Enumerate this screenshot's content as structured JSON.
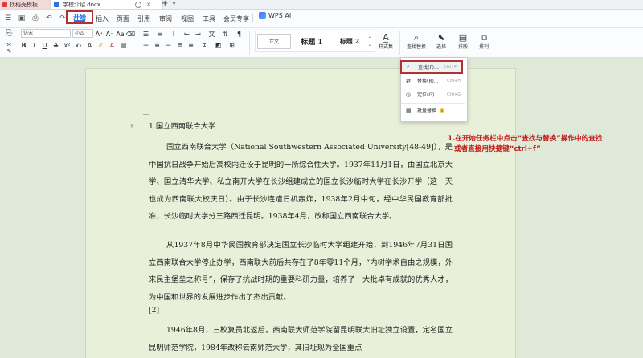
{
  "tabs": {
    "first_label": "找稻壳模板",
    "doc_label": "学校介绍.docx",
    "add": "+",
    "dropdown": "∨"
  },
  "menus": {
    "start": "开始",
    "insert": "插入",
    "page": "页面",
    "reference": "引用",
    "review": "审阅",
    "view": "视图",
    "tools": "工具",
    "member": "会员专享",
    "wps_ai": "WPS AI"
  },
  "ribbon": {
    "font_name": "仿宋",
    "font_size": "小四",
    "styles": [
      "正文",
      "标题 1",
      "标题 2"
    ],
    "style_set": "样式集",
    "find_replace": "查找替换",
    "select": "选择",
    "layout": "排版",
    "arrange": "排列"
  },
  "find_menu": {
    "find": {
      "label": "查找(F)...",
      "shortcut": "Ctrl+F"
    },
    "replace": {
      "label": "替换(R)...",
      "shortcut": "Ctrl+H"
    },
    "goto": {
      "label": "定位(G)...",
      "shortcut": "Ctrl+G"
    },
    "batch": {
      "label": "批量替换"
    }
  },
  "document": {
    "heading": "1.国立西南联合大学",
    "p1": "国立西南联合大学（National Southwestern Associated University[48-49]），是中国抗日战争开始后高校内迁设于昆明的一所综合性大学。1937年11月1日，由国立北京大学、国立清华大学、私立南开大学在长沙组建成立的国立长沙临时大学在长沙开学（这一天也成为西南联大校庆日）。由于长沙连遭日机轰炸，1938年2月中旬，经中华民国教育部批准，长沙临时大学分三路西迁昆明。1938年4月，改称国立西南联合大学。",
    "p2": "从1937年8月中华民国教育部决定国立长沙临时大学组建开始，到1946年7月31日国立西南联合大学停止办学，西南联大前后共存在了8年零11个月，“内树学术自由之规模，外来民主堡垒之称号”，保存了抗战时期的重要科研力量，培养了一大批卓有成就的优秀人才，为中国和世界的发展进步作出了杰出贡献。",
    "p3": "[2]",
    "p4": "1946年8月，三校复员北返后，西南联大师范学院留昆明联大旧址独立设置，定名国立昆明师范学院，1984年改称云南师范大学，其旧址现为全国重点"
  },
  "annotation": {
    "line1": "1.在开始任务栏中点击“查找与替换”操作中的查找",
    "line2": "或者直接用快捷键“ctrl+f”"
  }
}
